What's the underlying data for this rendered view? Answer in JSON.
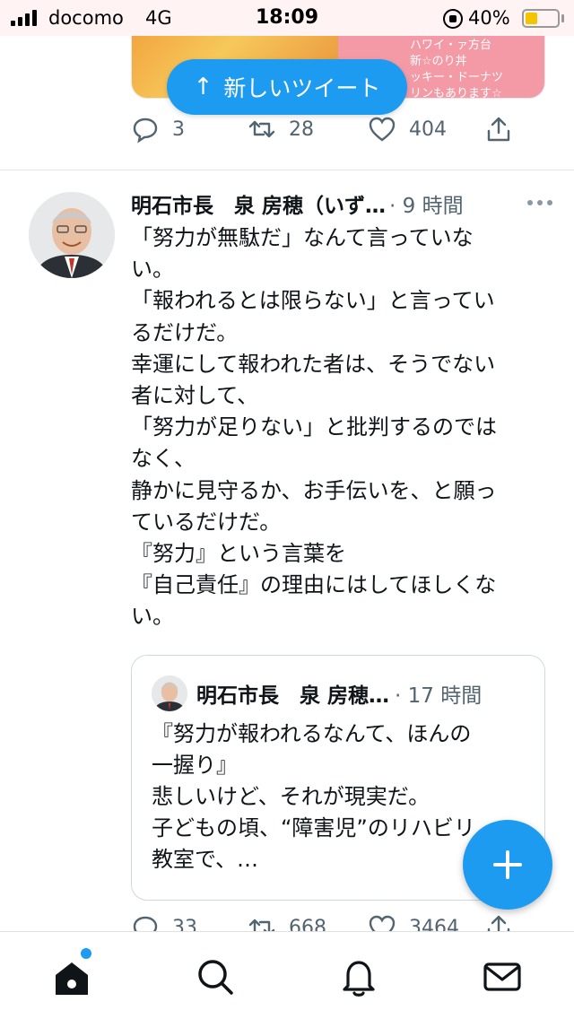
{
  "status_bar": {
    "carrier": "docomo",
    "network": "4G",
    "time": "18:09",
    "battery_percent": "40%"
  },
  "previous_tweet": {
    "media_text_lines": [
      "ハワイ・ァ方台",
      "新☆のり丼",
      "ッキー・ドーナツ",
      "リンもあります☆"
    ],
    "reply_count": "3",
    "retweet_count": "28",
    "like_count": "404"
  },
  "new_tweets_pill": {
    "label": "新しいツイート"
  },
  "tweet": {
    "author": "明石市長　泉 房穂（いず…",
    "time": "· 9 時間",
    "lines": [
      "「努力が無駄だ」なんて言っていな",
      "い。",
      "「報われるとは限らない」と言ってい",
      "るだけだ。",
      "幸運にして報われた者は、そうでない",
      "者に対して、",
      "「努力が足りない」と批判するのでは",
      "なく、",
      "静かに見守るか、お手伝いを、と願っ",
      "ているだけだ。",
      "『努力』という言葉を",
      "『自己責任』の理由にはしてほしくな",
      "い。"
    ],
    "quote": {
      "author": "明石市長　泉 房穂…",
      "time": "· 17 時間",
      "lines": [
        "『努力が報われるなんて、ほんの",
        "一握り』",
        "悲しいけど、それが現実だ。",
        "子どもの頃、“障害児”のリハビリ",
        "教室で、…"
      ]
    },
    "reply_count": "33",
    "retweet_count": "668",
    "like_count": "3464"
  },
  "colors": {
    "accent": "#1d9bf0",
    "muted": "#536471"
  },
  "tab_bar": {
    "tabs": [
      "home-icon",
      "search-icon",
      "notifications-icon",
      "messages-icon"
    ]
  }
}
